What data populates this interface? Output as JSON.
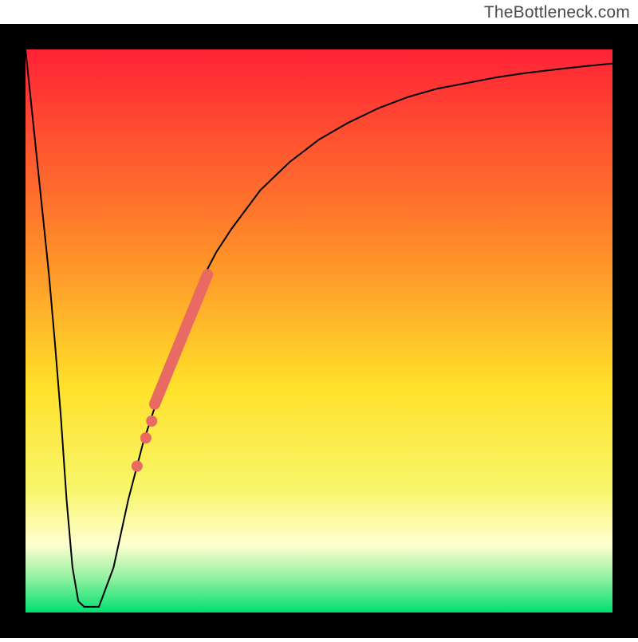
{
  "watermark": "TheBottleneck.com",
  "chart_data": {
    "type": "line",
    "title": "",
    "xlabel": "",
    "ylabel": "",
    "xlim": [
      0,
      100
    ],
    "ylim": [
      0,
      100
    ],
    "grid": false,
    "background_gradient": {
      "stops": [
        {
          "offset": 0.0,
          "color": "#ff2236"
        },
        {
          "offset": 0.35,
          "color": "#ff8a2a"
        },
        {
          "offset": 0.6,
          "color": "#ffe12a"
        },
        {
          "offset": 0.78,
          "color": "#f8f66a"
        },
        {
          "offset": 0.88,
          "color": "#ffffd0"
        },
        {
          "offset": 0.94,
          "color": "#8ff0a0"
        },
        {
          "offset": 1.0,
          "color": "#00e070"
        }
      ]
    },
    "series": [
      {
        "name": "curve",
        "color": "#000000",
        "stroke_width": 2,
        "x": [
          0,
          1,
          2,
          3,
          4,
          5,
          6,
          7,
          8,
          9,
          10,
          12.5,
          15,
          17.5,
          20,
          22.5,
          25,
          27.5,
          30,
          32.5,
          35,
          40,
          45,
          50,
          55,
          60,
          65,
          70,
          75,
          80,
          85,
          90,
          95,
          100
        ],
        "y": [
          100,
          90,
          80,
          70,
          60,
          48,
          35,
          20,
          8,
          2,
          1,
          1,
          8,
          20,
          30,
          38,
          46,
          53,
          59,
          64,
          68,
          75,
          80,
          84,
          87,
          89.5,
          91.5,
          93,
          94,
          95,
          95.8,
          96.4,
          97,
          97.5
        ],
        "note": "x as percent of inner plot width, y as percent of inner plot height from bottom"
      }
    ],
    "highlight_segment": {
      "name": "salmon-thick-segment",
      "color": "#e86a62",
      "stroke_width": 14,
      "x": [
        22,
        31
      ],
      "y": [
        37,
        60
      ]
    },
    "highlight_points": {
      "name": "salmon-dots",
      "color": "#e86a62",
      "radius": 7,
      "points": [
        {
          "x": 21.5,
          "y": 34
        },
        {
          "x": 20.5,
          "y": 31
        },
        {
          "x": 19.0,
          "y": 26
        }
      ]
    },
    "frame": {
      "stroke": "#000000",
      "stroke_width": 32
    }
  }
}
